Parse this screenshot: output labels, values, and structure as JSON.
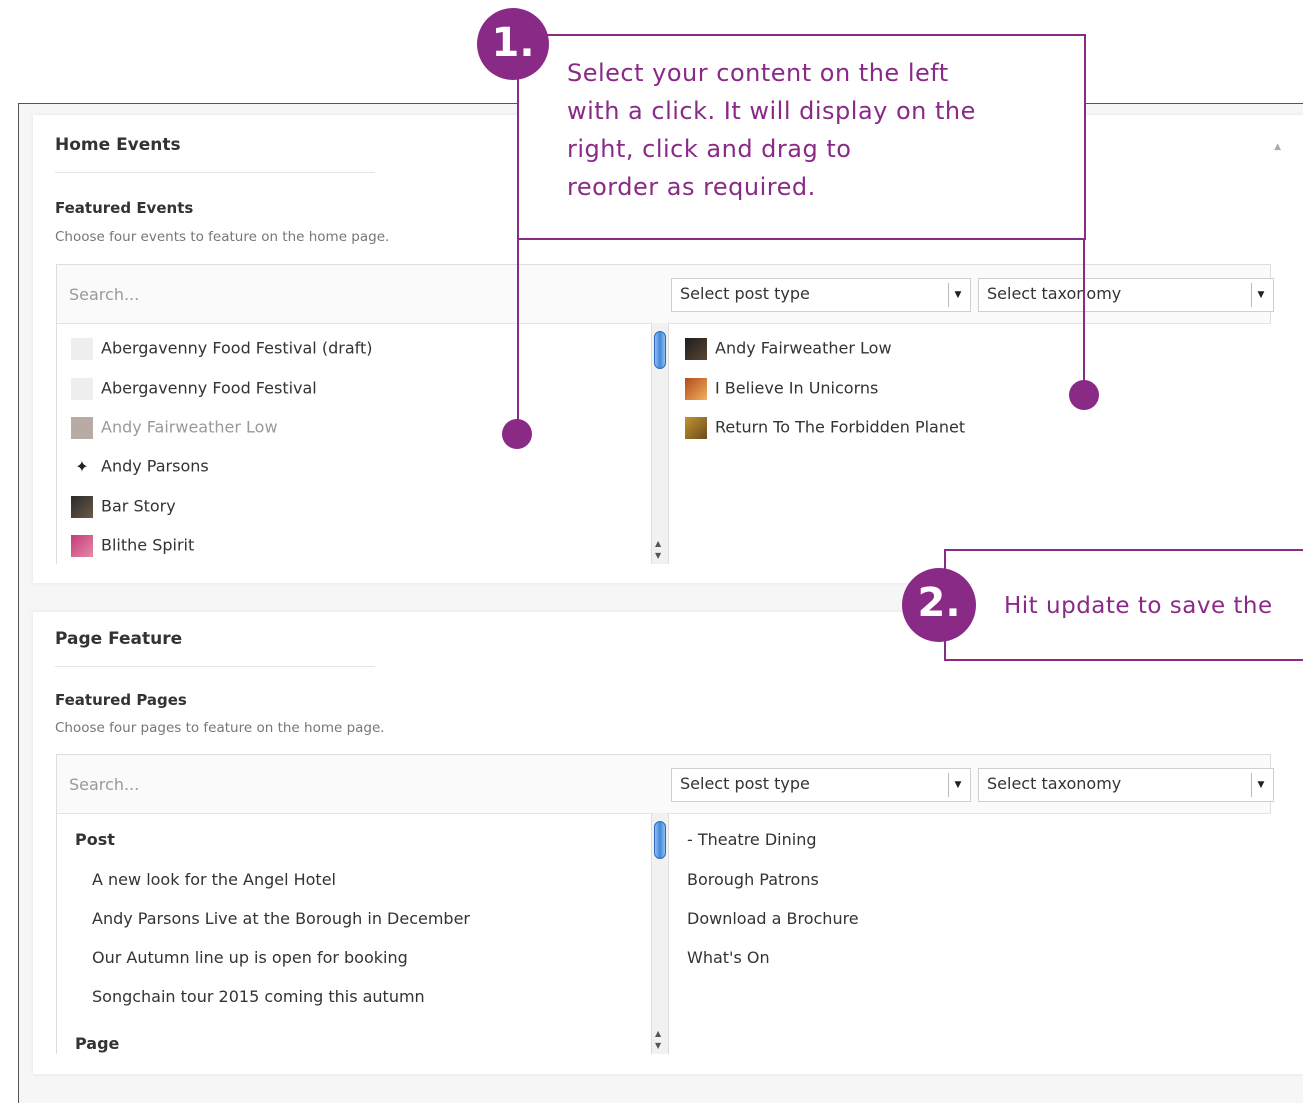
{
  "sections": [
    {
      "title": "Home Events",
      "field_label": "Featured Events",
      "field_desc": "Choose four events to feature on the home page.",
      "search_placeholder": "Search...",
      "post_type_select": "Select post type",
      "taxonomy_select": "Select taxonomy",
      "available": [
        {
          "label": "Abergavenny Food Festival (draft)",
          "thumb": "blank",
          "dim": false
        },
        {
          "label": "Abergavenny Food Festival",
          "thumb": "blank",
          "dim": false
        },
        {
          "label": "Andy Fairweather Low",
          "thumb": "photo-grey",
          "dim": true
        },
        {
          "label": "Andy Parsons",
          "thumb": "figure-icon",
          "dim": false
        },
        {
          "label": "Bar Story",
          "thumb": "photo-dark",
          "dim": false
        },
        {
          "label": "Blithe Spirit",
          "thumb": "photo-pink",
          "dim": false
        }
      ],
      "selected": [
        {
          "label": "Andy Fairweather Low",
          "thumb": "photo-dark"
        },
        {
          "label": "I Believe In Unicorns",
          "thumb": "photo-orange"
        },
        {
          "label": "Return To The Forbidden Planet",
          "thumb": "photo-gold"
        }
      ]
    },
    {
      "title": "Page Feature",
      "field_label": "Featured Pages",
      "field_desc": "Choose four pages to feature on the home page.",
      "search_placeholder": "Search...",
      "post_type_select": "Select post type",
      "taxonomy_select": "Select taxonomy",
      "available_groups": [
        {
          "group": "Post",
          "items": [
            "A new look for the Angel Hotel",
            "Andy Parsons Live at the Borough in December",
            "Our Autumn line up is open for booking",
            "Songchain tour 2015 coming this autumn"
          ]
        },
        {
          "group": "Page",
          "items": []
        }
      ],
      "selected": [
        "- Theatre Dining",
        "Borough Patrons",
        "Download a Brochure",
        "What's On"
      ]
    }
  ],
  "callouts": [
    {
      "number": "1.",
      "lines": [
        "Select your content on the left",
        "with a click. It will display on the",
        "right, click and drag to",
        "reorder as required."
      ]
    },
    {
      "number": "2.",
      "text": "Hit update to save the"
    }
  ],
  "colors": {
    "accent": "#8a2a87",
    "scroll_thumb": "#3f87da"
  }
}
